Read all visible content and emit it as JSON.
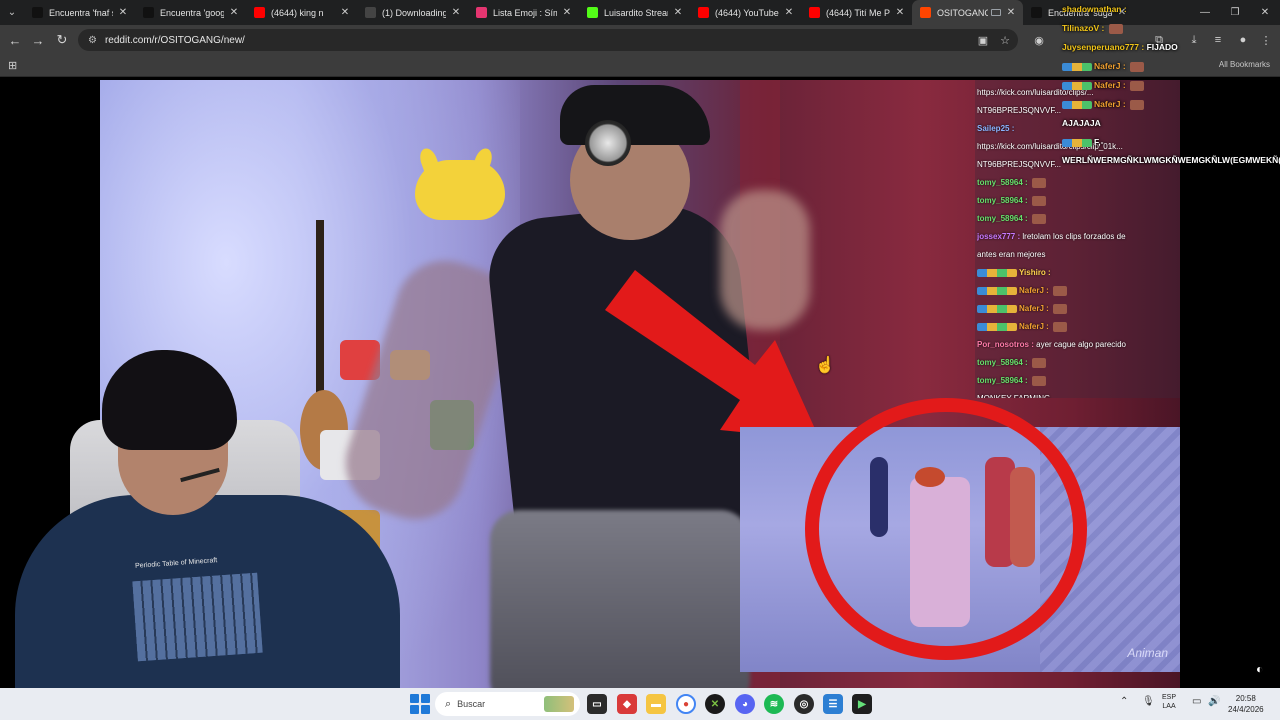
{
  "browser": {
    "tabs": [
      {
        "label": "Encuentra 'fnaf si",
        "favicon": "tiktok-icon",
        "color": "#111111"
      },
      {
        "label": "Encuentra 'googl",
        "favicon": "tiktok-icon",
        "color": "#111111"
      },
      {
        "label": "(4644) king n",
        "favicon": "youtube-icon",
        "color": "#ff0000"
      },
      {
        "label": "(1) Downloading",
        "favicon": "lightning-icon",
        "color": "#444444"
      },
      {
        "label": "Lista Emoji : Símb",
        "favicon": "bookmark-icon",
        "color": "#e53570"
      },
      {
        "label": "Luisardito Stream",
        "favicon": "kick-icon",
        "color": "#53fc18"
      },
      {
        "label": "(4644) YouTube",
        "favicon": "youtube-icon",
        "color": "#ff0000"
      },
      {
        "label": "(4644) Tití Me Pre",
        "favicon": "youtube-icon",
        "color": "#ff0000"
      },
      {
        "label": "OSITOGANG",
        "favicon": "reddit-icon",
        "color": "#ff4500",
        "active": true
      },
      {
        "label": "Encuentra 'sugar",
        "favicon": "tiktok-icon",
        "color": "#111111"
      }
    ],
    "url": "reddit.com/r/OSITOGANG/new/",
    "bookmarks_label": "All Bookmarks"
  },
  "chat_overlay": {
    "lines": [
      {
        "user": "",
        "text": "https://kick.com/luisardito/clips/...",
        "user_color": "#ffffff"
      },
      {
        "user": "",
        "text": "NT96BPREJSQNVVF...",
        "user_color": "#ffffff"
      },
      {
        "user": "Sailep25 :",
        "text": "",
        "user_color": "#8ab4ff"
      },
      {
        "user": "",
        "text": "https://kick.com/luisardito/clips/clip_01k...",
        "user_color": "#ffffff"
      },
      {
        "user": "",
        "text": "NT96BPREJSQNVVF...",
        "user_color": "#ffffff"
      },
      {
        "user": "tomy_58964 :",
        "text": "",
        "user_color": "#67e06b",
        "emote": true
      },
      {
        "user": "tomy_58964 :",
        "text": "",
        "user_color": "#67e06b",
        "emote": true
      },
      {
        "user": "tomy_58964 :",
        "text": "",
        "user_color": "#67e06b",
        "emote": true
      },
      {
        "user": "jossex777 :",
        "text": "lretolam los clips forzados de",
        "user_color": "#c779ff"
      },
      {
        "user": "",
        "text": "antes eran mejores",
        "user_color": "#ffffff"
      },
      {
        "user": "Yishiro :",
        "text": "",
        "user_color": "#ffd34d",
        "badges": true
      },
      {
        "user": "NaferJ :",
        "text": "",
        "user_color": "#f0a030",
        "badges": true,
        "emote": true
      },
      {
        "user": "NaferJ :",
        "text": "",
        "user_color": "#f0a030",
        "badges": true,
        "emote": true
      },
      {
        "user": "NaferJ :",
        "text": "",
        "user_color": "#f0a030",
        "badges": true,
        "emote": true
      },
      {
        "user": "Por_nosotros :",
        "text": "ayer cague algo parecido",
        "user_color": "#ff7aa8"
      },
      {
        "user": "tomy_58964 :",
        "text": "",
        "user_color": "#67e06b",
        "emote": true
      },
      {
        "user": "tomy_58964 :",
        "text": "",
        "user_color": "#67e06b",
        "emote": true
      },
      {
        "user": "",
        "text": "MONKEY FARMING",
        "user_color": "#ffffff"
      },
      {
        "user": "",
        "text": "MONKEY FARMING",
        "user_color": "#ffffff"
      }
    ]
  },
  "chat_top": {
    "lines": [
      {
        "user": "shadownathan :",
        "text": "",
        "user_color": "#f0c419"
      },
      {
        "user": "TilinazoV :",
        "text": "",
        "user_color": "#f0c419",
        "emote": true
      },
      {
        "user": "",
        "text": "",
        "user_color": "#ff6b6b"
      },
      {
        "user": "Juysenperuano777 :",
        "text": "FIJADO",
        "user_color": "#f0c419"
      },
      {
        "user": "NaferJ :",
        "text": "",
        "user_color": "#f0a030",
        "badges": true,
        "emote": true
      },
      {
        "user": "NaferJ :",
        "text": "",
        "user_color": "#f0a030",
        "badges": true,
        "emote": true
      },
      {
        "user": "NaferJ :",
        "text": "",
        "user_color": "#f0a030",
        "badges": true,
        "emote": true
      },
      {
        "user": "",
        "text": "AJAJAJA",
        "user_color": "#ff6b6b"
      },
      {
        "user": "",
        "text": "F,-",
        "user_color": "#ff6b6b",
        "badges": true
      },
      {
        "user": "",
        "text": "WERLÑWERMGÑKLWMGKÑWEMGKÑLW(EGMWEKÑ(GMWEGW",
        "user_color": "#ffffff",
        "wrap": true
      }
    ]
  },
  "video": {
    "watermark": "Animan"
  },
  "webcam": {
    "shirt_text": "Periodic Table of Minecraft"
  },
  "taskbar": {
    "search_placeholder": "Buscar",
    "lang_line1": "ESP",
    "lang_line2": "LAA",
    "time": "20:58",
    "date": "24/4/2026",
    "apps": [
      "explorer-icon",
      "files-icon",
      "folder-icon",
      "chrome-icon",
      "xbox-icon",
      "discord-icon",
      "spotify-icon",
      "obs-icon",
      "notepad-icon",
      "terminal-icon"
    ]
  },
  "colors": {
    "accent_red": "#e21a1a",
    "chrome_dark": "#3c3c3c",
    "taskbar_bg": "#e9ecf2"
  }
}
